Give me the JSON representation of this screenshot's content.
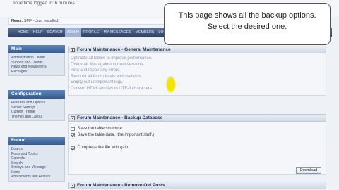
{
  "top_info": {
    "line1": "Total time logged in: 6 minutes.",
    "line2": ""
  },
  "news": {
    "label": "News:",
    "text": "SMF - Just Installed!"
  },
  "nav": [
    "HOME",
    "HELP",
    "SEARCH",
    "ADMIN",
    "PROFILE",
    "MY MESSAGES",
    "MEMBERS",
    "LOGOUT"
  ],
  "sidebar": {
    "main": {
      "title": "Main",
      "items": [
        "Administration Center",
        "Support and Credits",
        "News and Newsletters",
        "Packages"
      ]
    },
    "configuration": {
      "title": "Configuration",
      "items": [
        "Features and Options",
        "Server Settings",
        "Current Theme",
        "Themes and Layout"
      ]
    },
    "forum": {
      "title": "Forum",
      "items": [
        "Boards",
        "Posts and Topics",
        "Calendar",
        "Search",
        "Smileys and Message",
        "Icons",
        "Attachments and Avatars"
      ]
    }
  },
  "general": {
    "title": "Forum Maintenance - General Maintenance",
    "links": [
      "Optimize all tables to improve performance.",
      "Check all files against current versions.",
      "Find and repair any errors.",
      "Recount all forum totals and statistics.",
      "Empty out unimportant logs.",
      "Convert HTML-entities to UTF-8 characters"
    ]
  },
  "backup": {
    "title": "Forum Maintenance - Backup Database",
    "options": [
      {
        "label": "Save the table structure.",
        "checked": false
      },
      {
        "label": "Save the table data. (the important stuff.)",
        "checked": true
      },
      {
        "label": "Compress the file with gzip.",
        "checked": true
      }
    ],
    "download_label": "Download"
  },
  "remove": {
    "title": "Forum Maintenance - Remove Old Posts"
  },
  "callout": {
    "line1": "This page shows all the backup options.",
    "line2": "Select the desired one."
  }
}
